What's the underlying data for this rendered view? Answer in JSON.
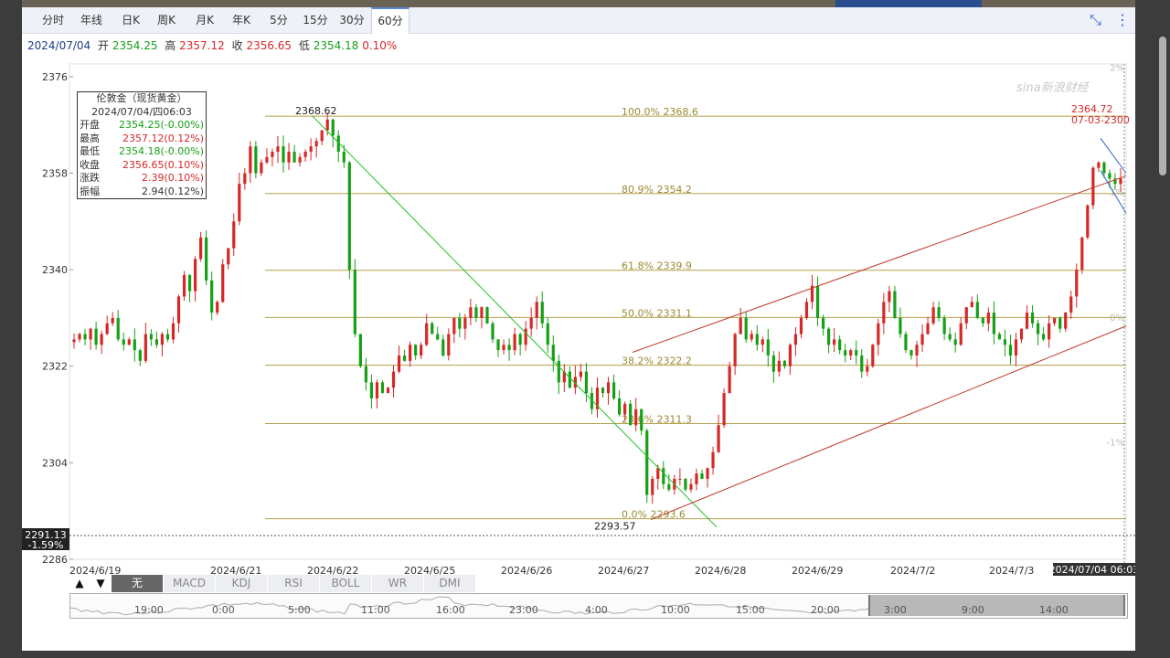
{
  "toolbar": {
    "tabs": [
      {
        "label": "分时",
        "left": 12,
        "width": 44
      },
      {
        "label": "年线",
        "left": 56,
        "width": 40
      },
      {
        "label": "日K",
        "left": 98,
        "width": 42
      },
      {
        "label": "周K",
        "left": 138,
        "width": 40
      },
      {
        "label": "月K",
        "left": 180,
        "width": 40
      },
      {
        "label": "年K",
        "left": 220,
        "width": 40
      },
      {
        "label": "5分",
        "left": 260,
        "width": 42
      },
      {
        "label": "15分",
        "left": 300,
        "width": 42
      },
      {
        "label": "30分",
        "left": 340,
        "width": 42
      },
      {
        "label": "60分",
        "left": 382,
        "width": 40
      }
    ],
    "active_tab": "60分"
  },
  "quote": {
    "date": "2024/07/04",
    "open_label": "开",
    "open": "2354.25",
    "high_label": "高",
    "high": "2357.12",
    "close_label": "收",
    "close": "2356.65",
    "low_label": "低",
    "low": "2354.18",
    "change_pct": "0.10%"
  },
  "infobox": {
    "title": "伦敦金（现货黄金）",
    "datetime": "2024/07/04/四06:03",
    "rows": [
      {
        "k": "开盘",
        "v": "2354.25(-0.00%)",
        "c": "#16a016"
      },
      {
        "k": "最高",
        "v": "2357.12(0.12%)",
        "c": "#d62828"
      },
      {
        "k": "最低",
        "v": "2354.18(-0.00%)",
        "c": "#16a016"
      },
      {
        "k": "收盘",
        "v": "2356.65(0.10%)",
        "c": "#d62828"
      },
      {
        "k": "涨跌",
        "v": "2.39(0.10%)",
        "c": "#d62828"
      },
      {
        "k": "振幅",
        "v": "2.94(0.12%)",
        "c": "#333333"
      }
    ]
  },
  "watermark": "sina新浪财经",
  "indicators": [
    "无",
    "MACD",
    "KDJ",
    "RSI",
    "BOLL",
    "WR",
    "DMI"
  ],
  "indicator_active": "无",
  "navigator_labels": [
    "19:00",
    "0:00",
    "5:00",
    "11:00",
    "16:00",
    "23:00",
    "4:00",
    "10:00",
    "15:00",
    "20:00",
    "3:00",
    "9:00",
    "14:00"
  ],
  "crosshair": {
    "price": "2291.13",
    "pct": "-1.59%",
    "time": "2024/07/04 06:03"
  },
  "chart_data": {
    "type": "candlestick",
    "title": "伦敦金（现货黄金） 60分",
    "ylim": [
      2286,
      2377
    ],
    "y_ticks": [
      "2376",
      "2358",
      "2340",
      "2322",
      "2304",
      "2286"
    ],
    "right_ticks": [
      "2%",
      "1%",
      "0%",
      "-1%",
      "-2%"
    ],
    "x_tick_labels": [
      "2024/6/19",
      "2024/6/21",
      "2024/6/22",
      "2024/6/25",
      "2024/6/26",
      "2024/6/27",
      "2024/6/28",
      "2024/6/29",
      "2024/7/2",
      "2024/7/3"
    ],
    "fib_levels": [
      {
        "label": "100.0% 2368.6",
        "value": 2368.62
      },
      {
        "label": "80.9% 2354.2",
        "value": 2354.2
      },
      {
        "label": "61.8% 2339.9",
        "value": 2339.9
      },
      {
        "label": "50.0% 2331.1",
        "value": 2331.1
      },
      {
        "label": "38.2% 2322.2",
        "value": 2322.2
      },
      {
        "label": "23.6% 2311.3",
        "value": 2311.3
      },
      {
        "label": "0.0% 2293.6",
        "value": 2293.57
      }
    ],
    "annotations": [
      {
        "text": "2368.62",
        "value": 2368.62
      },
      {
        "text": "2293.57",
        "value": 2293.57
      },
      {
        "text": "2364.72",
        "value": 2364.72
      },
      {
        "text": "07-03-2300"
      }
    ],
    "closes": [
      2327,
      2328,
      2327,
      2329,
      2326,
      2328,
      2330,
      2331,
      2327,
      2326,
      2327,
      2325,
      2323,
      2328,
      2327,
      2326,
      2328,
      2327,
      2330,
      2335,
      2339,
      2336,
      2342,
      2346,
      2338,
      2332,
      2334,
      2341,
      2344,
      2349,
      2356,
      2358,
      2363,
      2358,
      2360,
      2361,
      2362,
      2363,
      2360,
      2362,
      2360,
      2361,
      2362,
      2363,
      2364,
      2366,
      2368,
      2365,
      2362,
      2360,
      2340,
      2328,
      2322,
      2319,
      2316,
      2319,
      2317,
      2318,
      2321,
      2324,
      2323,
      2326,
      2324,
      2326,
      2330,
      2328,
      2327,
      2324,
      2328,
      2331,
      2329,
      2331,
      2333,
      2331,
      2333,
      2330,
      2327,
      2325,
      2326,
      2325,
      2328,
      2326,
      2329,
      2331,
      2334,
      2330,
      2326,
      2323,
      2319,
      2321,
      2318,
      2320,
      2321,
      2317,
      2314,
      2318,
      2317,
      2319,
      2316,
      2313,
      2315,
      2311,
      2314,
      2310,
      2298,
      2301,
      2303,
      2300,
      2299,
      2301,
      2301,
      2299,
      2300,
      2302,
      2301,
      2303,
      2306,
      2311,
      2317,
      2322,
      2328,
      2331,
      2327,
      2328,
      2326,
      2327,
      2324,
      2321,
      2323,
      2322,
      2326,
      2328,
      2331,
      2334,
      2337,
      2331,
      2329,
      2326,
      2327,
      2325,
      2324,
      2325,
      2324,
      2321,
      2322,
      2326,
      2330,
      2334,
      2336,
      2331,
      2328,
      2325,
      2324,
      2326,
      2328,
      2330,
      2333,
      2331,
      2328,
      2327,
      2326,
      2330,
      2333,
      2334,
      2331,
      2330,
      2332,
      2328,
      2327,
      2326,
      2324,
      2327,
      2329,
      2332,
      2330,
      2328,
      2327,
      2330,
      2331,
      2329,
      2332,
      2335,
      2340,
      2346,
      2352,
      2359,
      2360,
      2358,
      2357,
      2356,
      2357
    ]
  }
}
